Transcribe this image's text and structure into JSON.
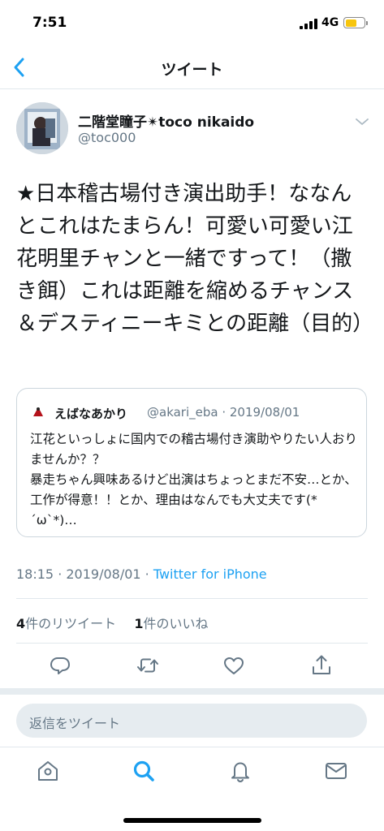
{
  "status_bar": {
    "time": "7:51",
    "network": "4G"
  },
  "nav": {
    "title": "ツイート",
    "back_icon": "chevron-left-icon"
  },
  "tweet": {
    "author_name": "二階堂瞳子✴︎toco nikaido",
    "author_handle": "@toc000",
    "text": "★日本稽古場付き演出助手！ななんとこれはたまらん！可愛い可愛い江花明里チャンと一緒ですって！（撒き餌）これは距離を縮めるチャンス＆デスティニーキミとの距離（目的）",
    "timestamp": "18:15 · 2019/08/01 · ",
    "source": "Twitter for iPhone"
  },
  "quoted_tweet": {
    "author_name": "えばなあかり",
    "meta": "@akari_eba · 2019/08/01",
    "text": "江花といっしょに国内での稽古場付き演助やりたい人おりませんか？？\n暴走ちゃん興味あるけど出演はちょっとまだ不安…とか、工作が得意！！とか、理由はなんでも大丈夫です(*´ω`*)…"
  },
  "stats": {
    "retweet_count": "4",
    "retweet_label": "件のリツイート",
    "like_count": "1",
    "like_label": "件のいいね"
  },
  "actions": [
    "reply-icon",
    "retweet-icon",
    "like-icon",
    "share-icon"
  ],
  "reply_box": {
    "placeholder": "返信をツイート"
  },
  "tab_bar": {
    "tabs": [
      "home-icon",
      "search-icon",
      "notifications-icon",
      "messages-icon"
    ],
    "active": "search-icon"
  },
  "colors": {
    "accent": "#1da1f2",
    "text": "#14171a",
    "secondary_text": "#657786",
    "divider": "#e1e8ed",
    "battery": "#f7c50d"
  }
}
